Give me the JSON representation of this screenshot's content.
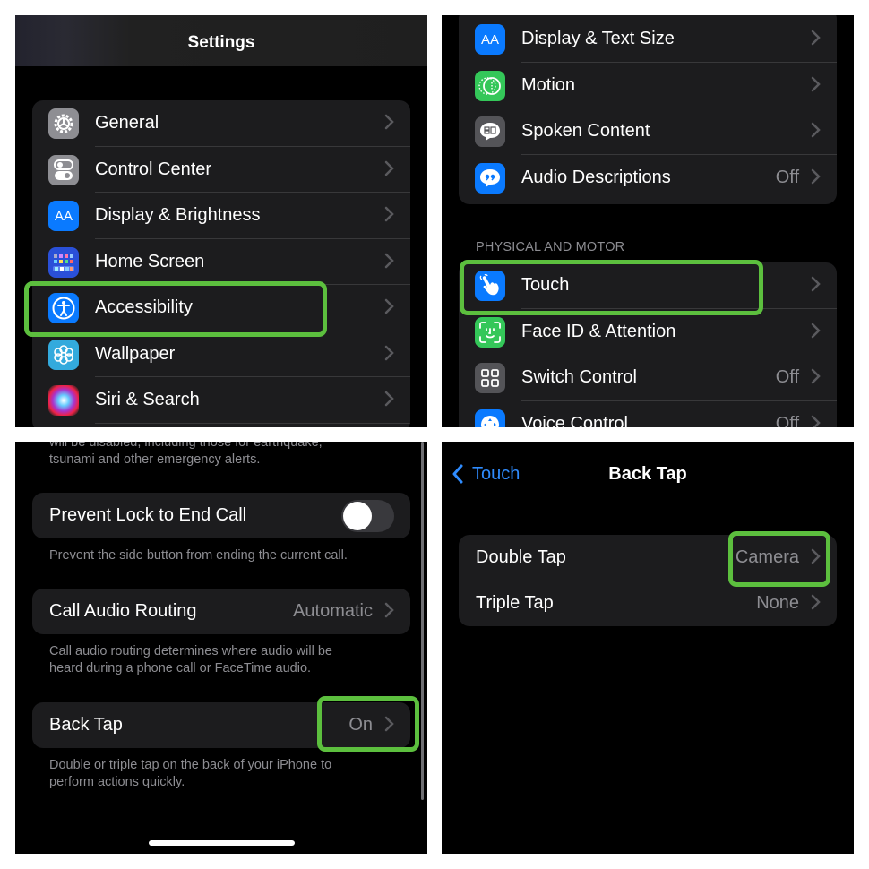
{
  "panel1": {
    "title": "Settings",
    "items": [
      {
        "label": "General",
        "icon": "gear-icon",
        "color": "#8e8e93"
      },
      {
        "label": "Control Center",
        "icon": "switches-icon",
        "color": "#8e8e93"
      },
      {
        "label": "Display & Brightness",
        "icon": "text-size-icon",
        "color": "#0a7aff"
      },
      {
        "label": "Home Screen",
        "icon": "app-grid-icon",
        "color": "#2a50d8"
      },
      {
        "label": "Accessibility",
        "icon": "accessibility-icon",
        "color": "#0a7aff"
      },
      {
        "label": "Wallpaper",
        "icon": "flower-icon",
        "color": "#33aadd"
      },
      {
        "label": "Siri & Search",
        "icon": "siri-icon",
        "color": "#222"
      }
    ],
    "highlighted": "Accessibility"
  },
  "panel2": {
    "vision_items": [
      {
        "label": "Display & Text Size",
        "icon": "text-size-icon",
        "color": "#0a7aff",
        "value": ""
      },
      {
        "label": "Motion",
        "icon": "motion-icon",
        "color": "#34c759",
        "value": ""
      },
      {
        "label": "Spoken Content",
        "icon": "speech-bubble-icon",
        "color": "#545458",
        "value": ""
      },
      {
        "label": "Audio Descriptions",
        "icon": "quote-bubble-icon",
        "color": "#0a7aff",
        "value": "Off"
      }
    ],
    "section_header": "PHYSICAL AND MOTOR",
    "motor_items": [
      {
        "label": "Touch",
        "icon": "hand-pointer-icon",
        "color": "#0a7aff",
        "value": ""
      },
      {
        "label": "Face ID & Attention",
        "icon": "face-id-icon",
        "color": "#34c759",
        "value": ""
      },
      {
        "label": "Switch Control",
        "icon": "grid-squares-icon",
        "color": "#545458",
        "value": "Off"
      },
      {
        "label": "Voice Control",
        "icon": "voice-control-icon",
        "color": "#0a7aff",
        "value": "Off"
      }
    ],
    "highlighted": "Touch"
  },
  "panel3": {
    "top_footnote_line1": "will be disabled, including those for earthquake,",
    "top_footnote_line2": "tsunami and other emergency alerts.",
    "prevent_lock": {
      "label": "Prevent Lock to End Call",
      "on": false
    },
    "prevent_lock_footnote": "Prevent the side button from ending the current call.",
    "call_audio": {
      "label": "Call Audio Routing",
      "value": "Automatic"
    },
    "call_audio_footnote_line1": "Call audio routing determines where audio will be",
    "call_audio_footnote_line2": "heard during a phone call or FaceTime audio.",
    "back_tap": {
      "label": "Back Tap",
      "value": "On"
    },
    "back_tap_footnote_line1": "Double or triple tap on the back of your iPhone to",
    "back_tap_footnote_line2": "perform actions quickly."
  },
  "panel4": {
    "back_label": "Touch",
    "title": "Back Tap",
    "items": [
      {
        "label": "Double Tap",
        "value": "Camera"
      },
      {
        "label": "Triple Tap",
        "value": "None"
      }
    ],
    "highlighted": "Double Tap"
  },
  "colors": {
    "highlight": "#5cbf3e",
    "link": "#2f8cff",
    "background": "#000000",
    "cell": "#1c1c1e"
  }
}
